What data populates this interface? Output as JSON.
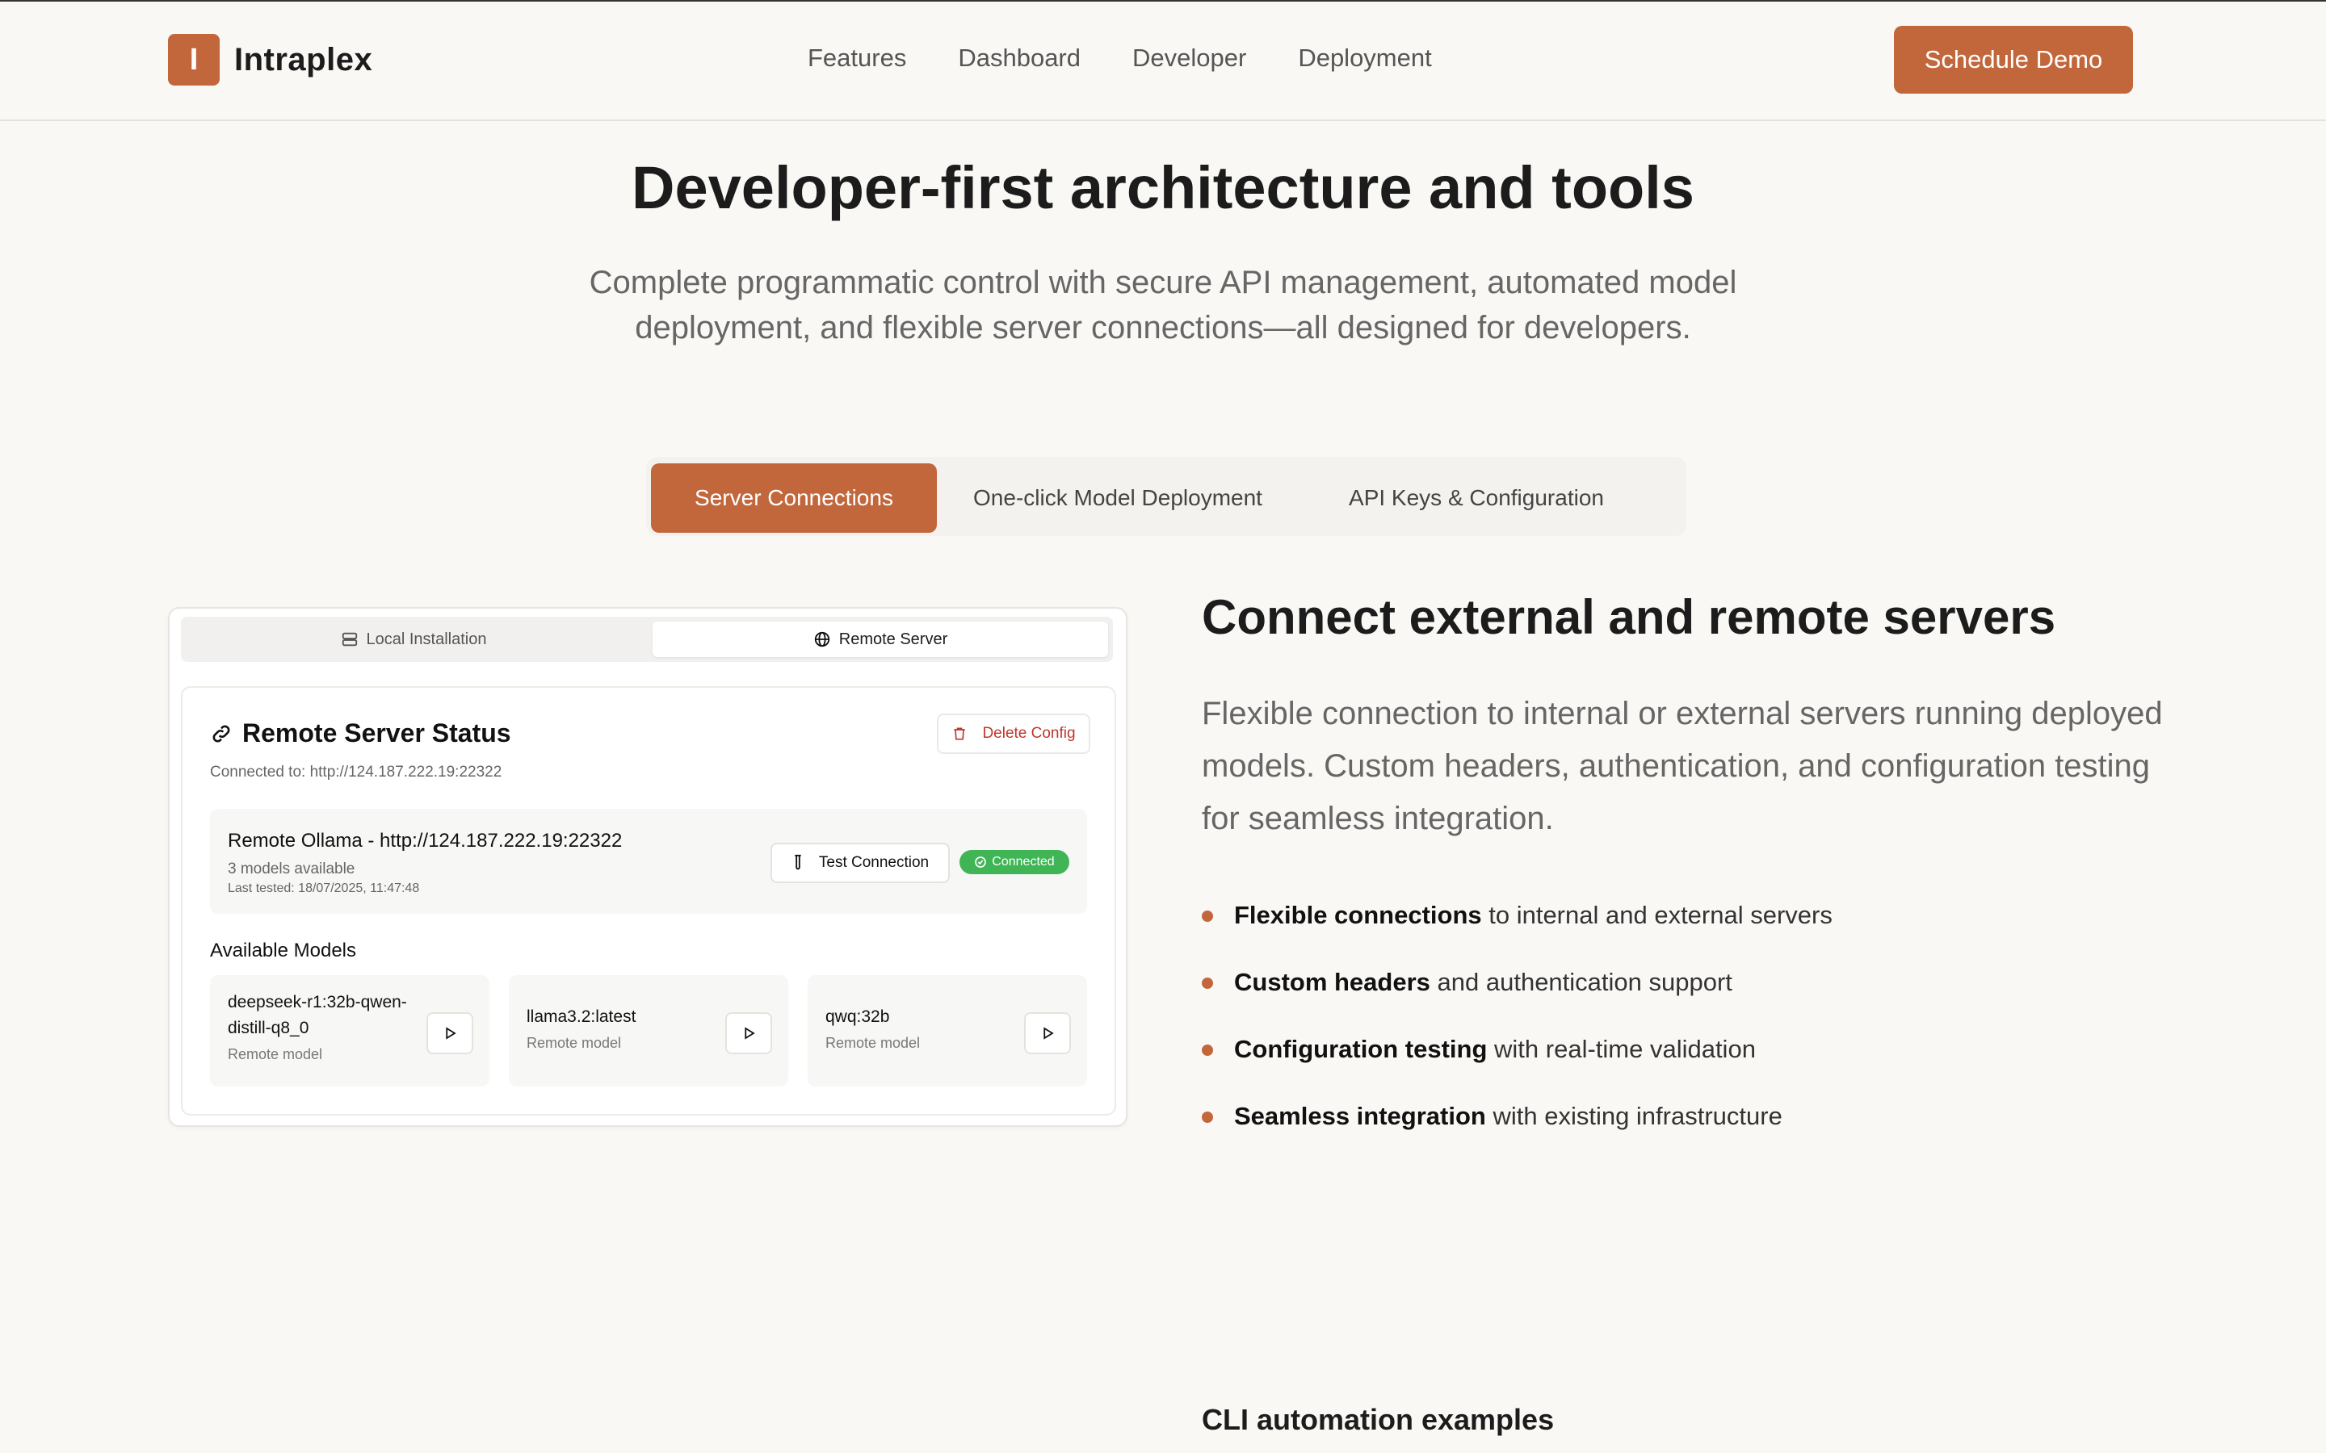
{
  "brand": {
    "logo_letter": "I",
    "name": "Intraplex",
    "accent": "#c2673c"
  },
  "nav": {
    "links": [
      "Features",
      "Dashboard",
      "Developer",
      "Deployment"
    ],
    "cta": "Schedule Demo"
  },
  "hero": {
    "title": "Developer-first architecture and tools",
    "subtitle": "Complete programmatic control with secure API management, automated model deployment, and flexible server connections—all designed for developers."
  },
  "tabs": [
    {
      "label": "Server Connections",
      "active": true
    },
    {
      "label": "One-click Model Deployment",
      "active": false
    },
    {
      "label": "API Keys & Configuration",
      "active": false
    }
  ],
  "card": {
    "segments": {
      "local": "Local Installation",
      "remote": "Remote Server",
      "selected": "Remote Server"
    },
    "status_title": "Remote Server Status",
    "connected_to": "Connected to: http://124.187.222.19:22322",
    "delete_label": "Delete Config",
    "server": {
      "name": "Remote Ollama - http://124.187.222.19:22322",
      "models_count": "3 models available",
      "last_tested": "Last tested: 18/07/2025, 11:47:48",
      "test_label": "Test Connection",
      "status": "Connected",
      "status_color": "#3fb556"
    },
    "available_title": "Available Models",
    "models": [
      {
        "name": "deepseek-r1:32b-qwen-distill-q8_0",
        "sub": "Remote model"
      },
      {
        "name": "llama3.2:latest",
        "sub": "Remote model"
      },
      {
        "name": "qwq:32b",
        "sub": "Remote model"
      }
    ]
  },
  "feature": {
    "title": "Connect external and remote servers",
    "description": "Flexible connection to internal or external servers running deployed models. Custom headers, authentication, and configuration testing for seamless integration.",
    "bullets": [
      {
        "bold": "Flexible connections",
        "rest": " to internal and external servers"
      },
      {
        "bold": "Custom headers",
        "rest": " and authentication support"
      },
      {
        "bold": "Configuration testing",
        "rest": " with real-time validation"
      },
      {
        "bold": "Seamless integration",
        "rest": " with existing infrastructure"
      }
    ]
  },
  "cli_title": "CLI automation examples"
}
